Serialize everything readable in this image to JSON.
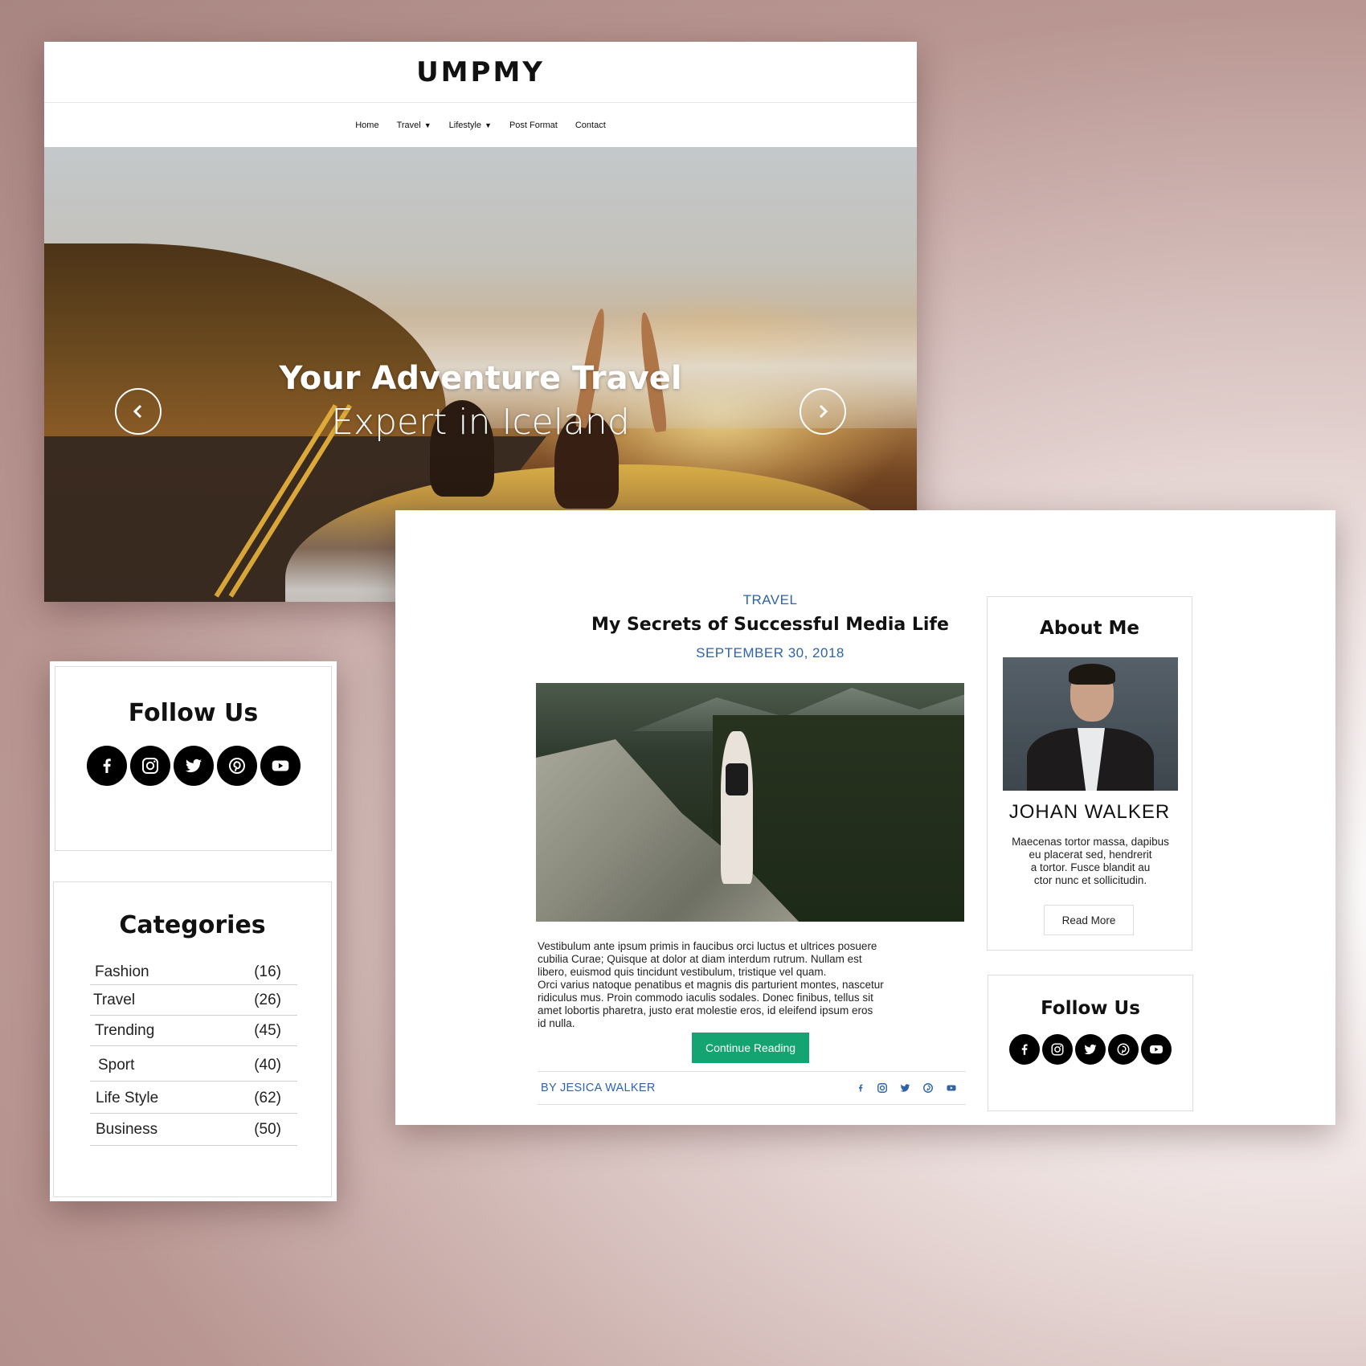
{
  "site": {
    "logo": "UMPMY",
    "nav": [
      {
        "label": "Home",
        "dropdown": false
      },
      {
        "label": "Travel",
        "dropdown": true
      },
      {
        "label": "Lifestyle",
        "dropdown": true
      },
      {
        "label": "Post Format",
        "dropdown": false
      },
      {
        "label": "Contact",
        "dropdown": false
      }
    ]
  },
  "hero": {
    "title": "Your Adventure Travel",
    "subtitle": "Expert in Iceland",
    "prev_icon": "chevron-left-icon",
    "next_icon": "chevron-right-icon"
  },
  "left_card": {
    "follow_title": "Follow Us",
    "categories_title": "Categories",
    "categories": [
      {
        "name": "Fashion",
        "count": "(16)"
      },
      {
        "name": "Travel",
        "count": "(26)"
      },
      {
        "name": "Trending",
        "count": "(45)"
      },
      {
        "name": "Sport",
        "count": "(40)"
      },
      {
        "name": "Life Style",
        "count": "(62)"
      },
      {
        "name": "Business",
        "count": "(50)"
      }
    ]
  },
  "social_icons": [
    "facebook-icon",
    "instagram-icon",
    "twitter-icon",
    "pinterest-icon",
    "youtube-icon"
  ],
  "post": {
    "category": "TRAVEL",
    "title": "My Secrets of Successful Media Life",
    "date": "SEPTEMBER 30, 2018",
    "excerpt_lines": [
      "Vestibulum ante ipsum primis in faucibus orci luctus et ultrices posuere",
      "cubilia Curae; Quisque at dolor at diam interdum rutrum. Nullam est",
      "libero, euismod quis tincidunt vestibulum, tristique vel quam.",
      "Orci varius natoque penatibus et magnis dis parturient montes, nascetur",
      "ridiculus mus. Proin commodo iaculis sodales. Donec finibus, tellus sit",
      "amet lobortis pharetra, justo erat molestie eros, id eleifend ipsum eros",
      "id nulla."
    ],
    "continue_label": "Continue Reading",
    "author": "BY JESICA WALKER"
  },
  "about": {
    "title": "About Me",
    "name": "JOHAN WALKER",
    "text_lines": [
      "Maecenas tortor massa, dapibus",
      "eu placerat sed, hendrerit",
      "a tortor. Fusce blandit au",
      "ctor nunc et sollicitudin."
    ],
    "read_more_label": "Read More"
  },
  "right_follow": {
    "title": "Follow Us"
  },
  "colors": {
    "accent_blue": "#2f63a8",
    "button_green": "#13a472",
    "text_dark": "#111111"
  }
}
